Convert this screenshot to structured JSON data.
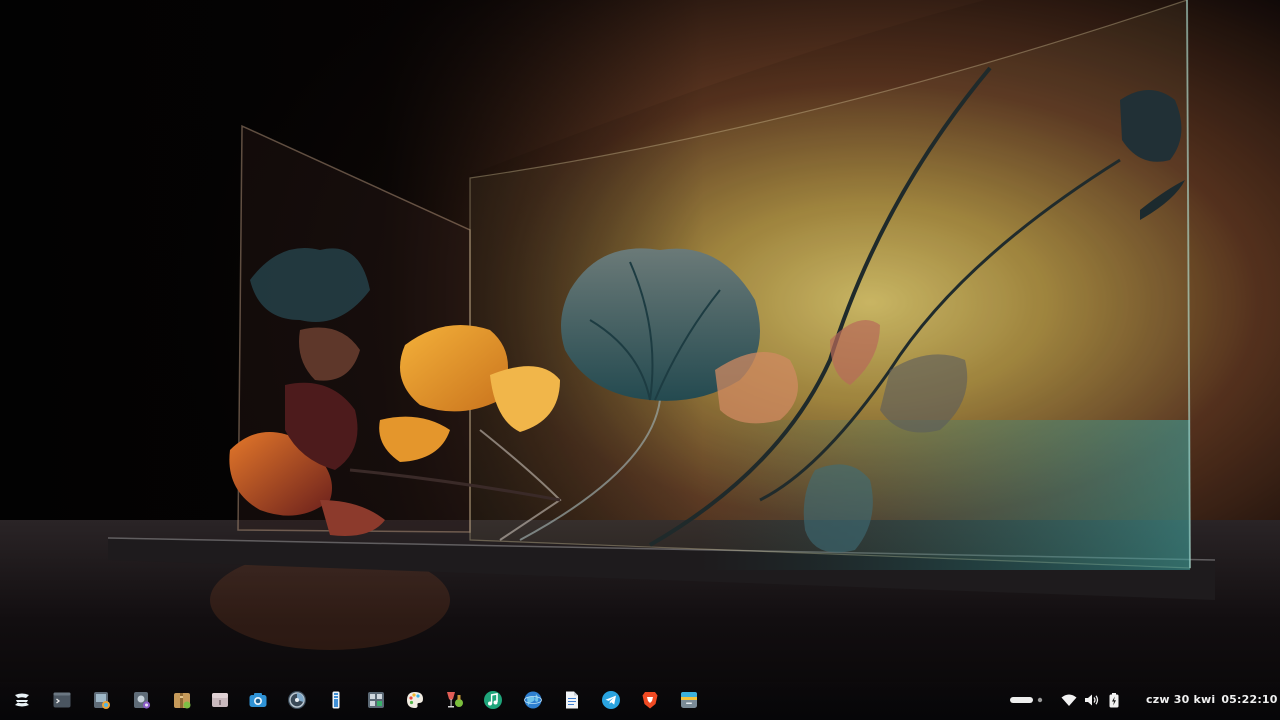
{
  "desktop": {
    "wallpaper": "glass-flowers-wallpaper"
  },
  "taskbar": {
    "launcher_icon": "zorin-logo-icon",
    "apps": [
      {
        "name": "terminal",
        "icon": "terminal-icon"
      },
      {
        "name": "image-viewer",
        "icon": "image-viewer-icon"
      },
      {
        "name": "settings-tool",
        "icon": "settings-app-icon"
      },
      {
        "name": "archive-manager",
        "icon": "archive-icon"
      },
      {
        "name": "disk-tool",
        "icon": "drive-icon"
      },
      {
        "name": "screenshot",
        "icon": "camera-icon"
      },
      {
        "name": "disk-usage",
        "icon": "disk-usage-icon"
      },
      {
        "name": "text-editor",
        "icon": "text-editor-icon"
      },
      {
        "name": "calculator",
        "icon": "calculator-icon"
      },
      {
        "name": "color-picker",
        "icon": "palette-icon"
      },
      {
        "name": "wine",
        "icon": "wine-glass-icon"
      },
      {
        "name": "music-player",
        "icon": "music-icon"
      },
      {
        "name": "web-browser",
        "icon": "globe-icon"
      },
      {
        "name": "document-viewer",
        "icon": "document-icon"
      },
      {
        "name": "telegram",
        "icon": "telegram-icon"
      },
      {
        "name": "brave",
        "icon": "brave-icon"
      },
      {
        "name": "files",
        "icon": "files-icon"
      }
    ]
  },
  "tray": {
    "workspace_icon": "workspace-indicator-icon",
    "wifi_icon": "wifi-icon",
    "volume_icon": "volume-icon",
    "battery_icon": "battery-charging-icon"
  },
  "clock": {
    "date": "czw 30 kwi",
    "time": "05:22:10"
  },
  "colors": {
    "taskbar_bg": "#0a080a",
    "clock_text": "#f0f0f0",
    "accent_teal": "#1e9e8e",
    "accent_orange": "#e89a2a"
  }
}
